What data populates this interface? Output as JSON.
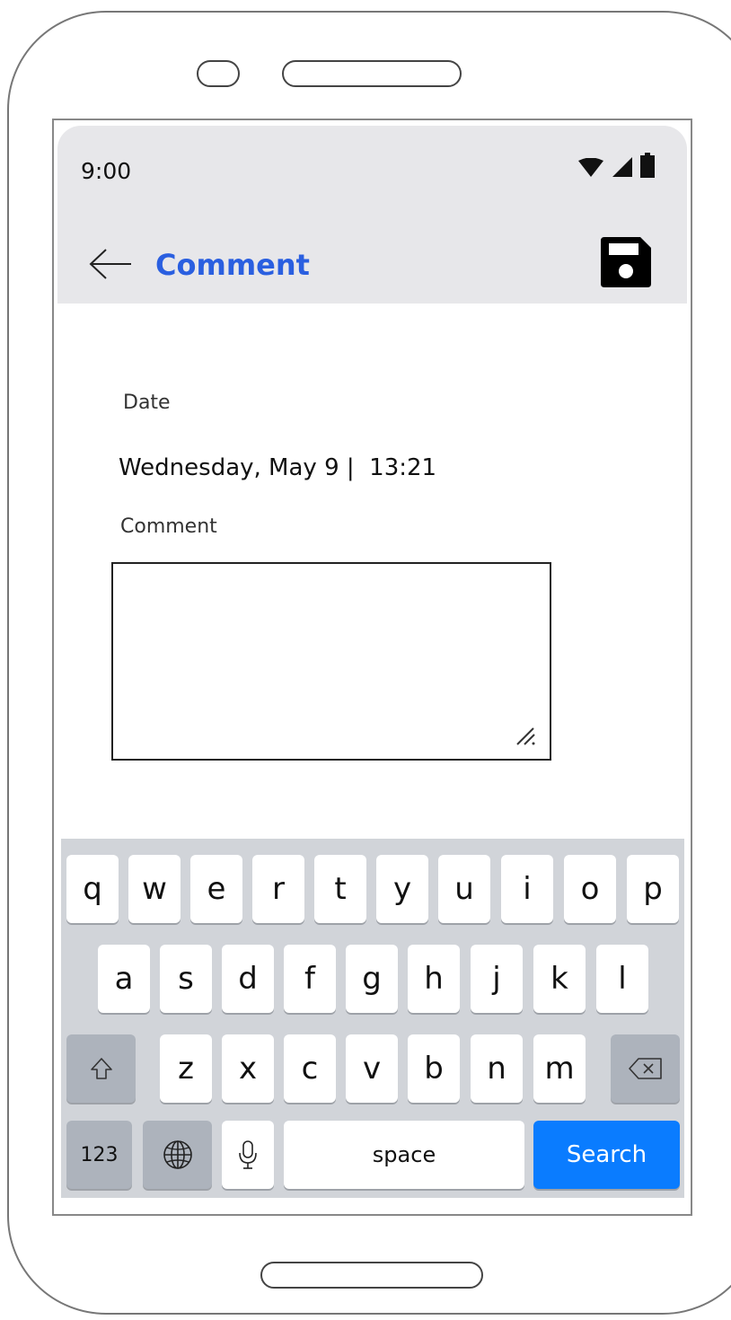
{
  "status_bar": {
    "time": "9:00",
    "icons": [
      "wifi-icon",
      "signal-icon",
      "battery-icon"
    ]
  },
  "header": {
    "title": "Comment",
    "back_icon": "arrow-left-icon",
    "save_icon": "floppy-disk-icon"
  },
  "form": {
    "date_label": "Date",
    "date_value": "Wednesday, May 9 |  13:21",
    "comment_label": "Comment",
    "comment_value": ""
  },
  "keyboard": {
    "row1": [
      "q",
      "w",
      "e",
      "r",
      "t",
      "y",
      "u",
      "i",
      "o",
      "p"
    ],
    "row2": [
      "a",
      "s",
      "d",
      "f",
      "g",
      "h",
      "j",
      "k",
      "l"
    ],
    "row3": [
      "z",
      "x",
      "c",
      "v",
      "b",
      "n",
      "m"
    ],
    "numbers_label": "123",
    "space_label": "space",
    "search_label": "Search",
    "shift_icon": "shift-icon",
    "backspace_icon": "backspace-icon",
    "globe_icon": "globe-icon",
    "mic_icon": "microphone-icon"
  },
  "colors": {
    "accent": "#2a5fe0",
    "header_bg": "#e7e7ea",
    "keyboard_bg": "#d1d4d9",
    "search_key": "#0a7cff"
  }
}
